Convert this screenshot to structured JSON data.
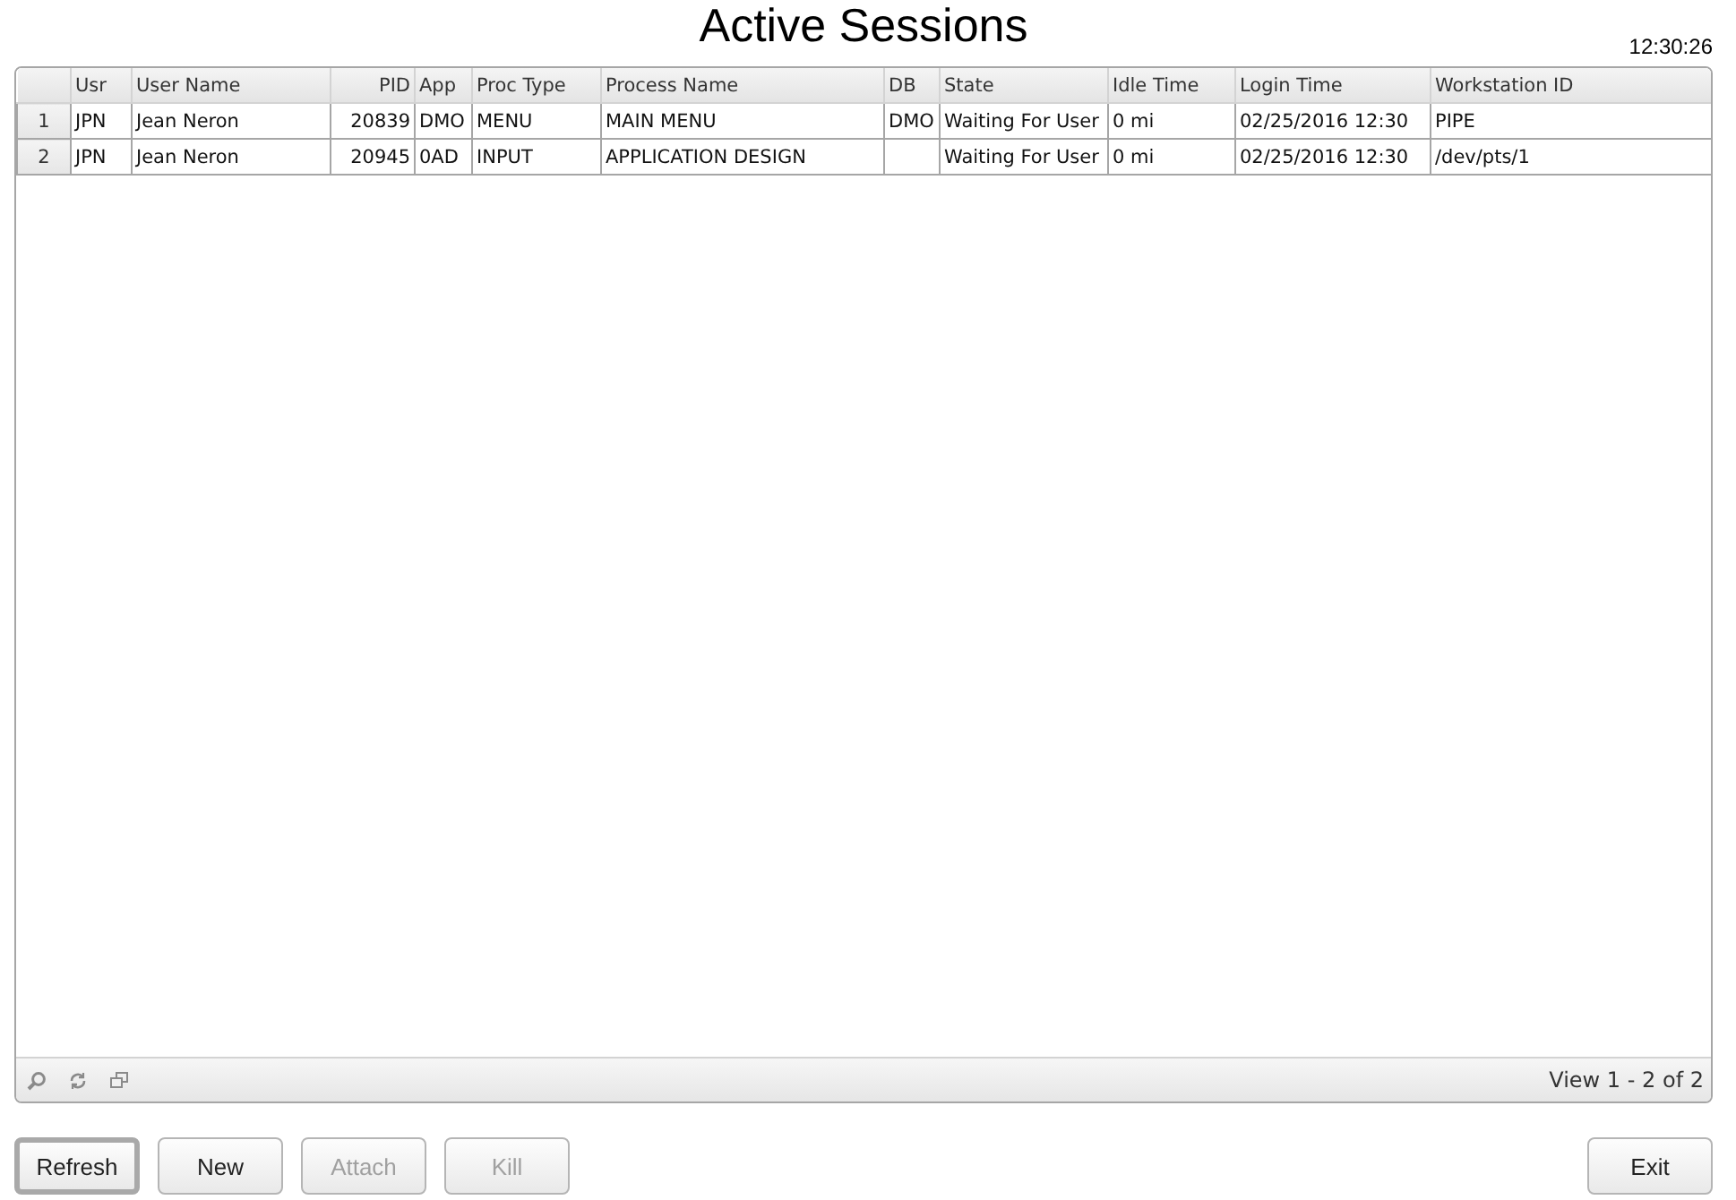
{
  "title": "Active Sessions",
  "clock": "12:30:26",
  "table": {
    "columns": [
      "Usr",
      "User Name",
      "PID",
      "App",
      "Proc Type",
      "Process Name",
      "DB",
      "State",
      "Idle Time",
      "Login Time",
      "Workstation ID"
    ],
    "row_numbers": [
      "1",
      "2"
    ],
    "rows": [
      [
        "JPN",
        "Jean Neron",
        "20839",
        "DMO",
        "MENU",
        "MAIN MENU",
        "DMO",
        "Waiting For User",
        "0 mi",
        "02/25/2016 12:30",
        "PIPE"
      ],
      [
        "JPN",
        "Jean Neron",
        "20945",
        "0AD",
        "INPUT",
        "APPLICATION DESIGN",
        "",
        "Waiting For User",
        "0 mi",
        "02/25/2016 12:30",
        "/dev/pts/1"
      ]
    ]
  },
  "pager": {
    "info": "View 1 - 2 of 2"
  },
  "buttons": [
    {
      "label": "Refresh",
      "disabled": false,
      "focused": true
    },
    {
      "label": "New",
      "disabled": false,
      "focused": false
    },
    {
      "label": "Attach",
      "disabled": true,
      "focused": false
    },
    {
      "label": "Kill",
      "disabled": true,
      "focused": false
    }
  ],
  "exit_button": {
    "label": "Exit",
    "disabled": false,
    "focused": false
  }
}
